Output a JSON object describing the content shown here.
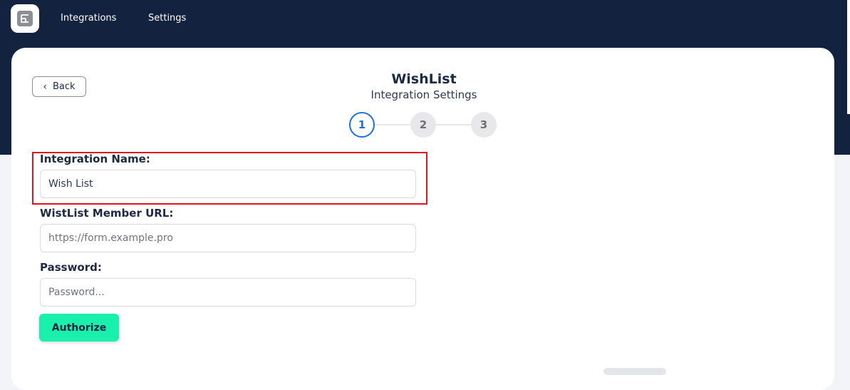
{
  "nav": {
    "logo_icon": "app-logo-icon",
    "items": [
      {
        "label": "Integrations"
      },
      {
        "label": "Settings"
      }
    ]
  },
  "header": {
    "back_label": "Back",
    "title": "WishList",
    "subtitle": "Integration Settings"
  },
  "stepper": {
    "current": 1,
    "steps": [
      "1",
      "2",
      "3"
    ]
  },
  "form": {
    "integration_name": {
      "label": "Integration Name:",
      "value": "Wish List"
    },
    "member_url": {
      "label": "WistList Member URL:",
      "placeholder": "https://form.example.pro"
    },
    "password": {
      "label": "Password:",
      "placeholder": "Password..."
    },
    "authorize_label": "Authorize"
  },
  "colors": {
    "topbar": "#13223f",
    "accent_blue": "#1d6fe8",
    "authorize_green": "#18f0ab",
    "highlight_red": "#e0141e"
  }
}
